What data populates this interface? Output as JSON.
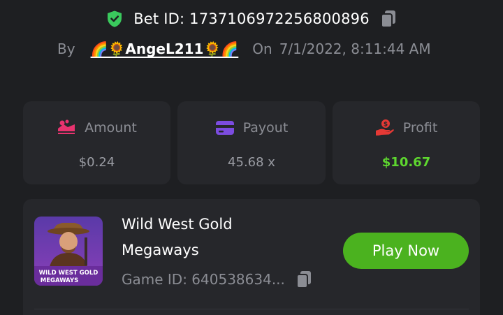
{
  "bet": {
    "id_text": "Bet ID: 1737106972256800896"
  },
  "meta": {
    "by_label": "By",
    "username": "🌈🌻AngeL211🌻🌈",
    "on_label": "On",
    "date": "7/1/2022, 8:11:44 AM"
  },
  "stats": {
    "amount": {
      "label": "Amount",
      "value": "$0.24"
    },
    "payout": {
      "label": "Payout",
      "value": "45.68 x"
    },
    "profit": {
      "label": "Profit",
      "value": "$10.67"
    }
  },
  "game": {
    "title": "Wild West Gold Megaways",
    "id_text": "Game ID: 640538634...",
    "play_label": "Play Now",
    "thumbnail_logo": "WILD WEST GOLD MEGAWAYS"
  },
  "colors": {
    "background": "#1e1f22",
    "card": "#26272b",
    "shield": "#3ac95d",
    "amount_icon": "#e8336f",
    "payout_icon": "#7c4ce0",
    "profit_icon": "#e53935",
    "profit_value": "#5ed72f",
    "play_button": "#4bb21f"
  }
}
